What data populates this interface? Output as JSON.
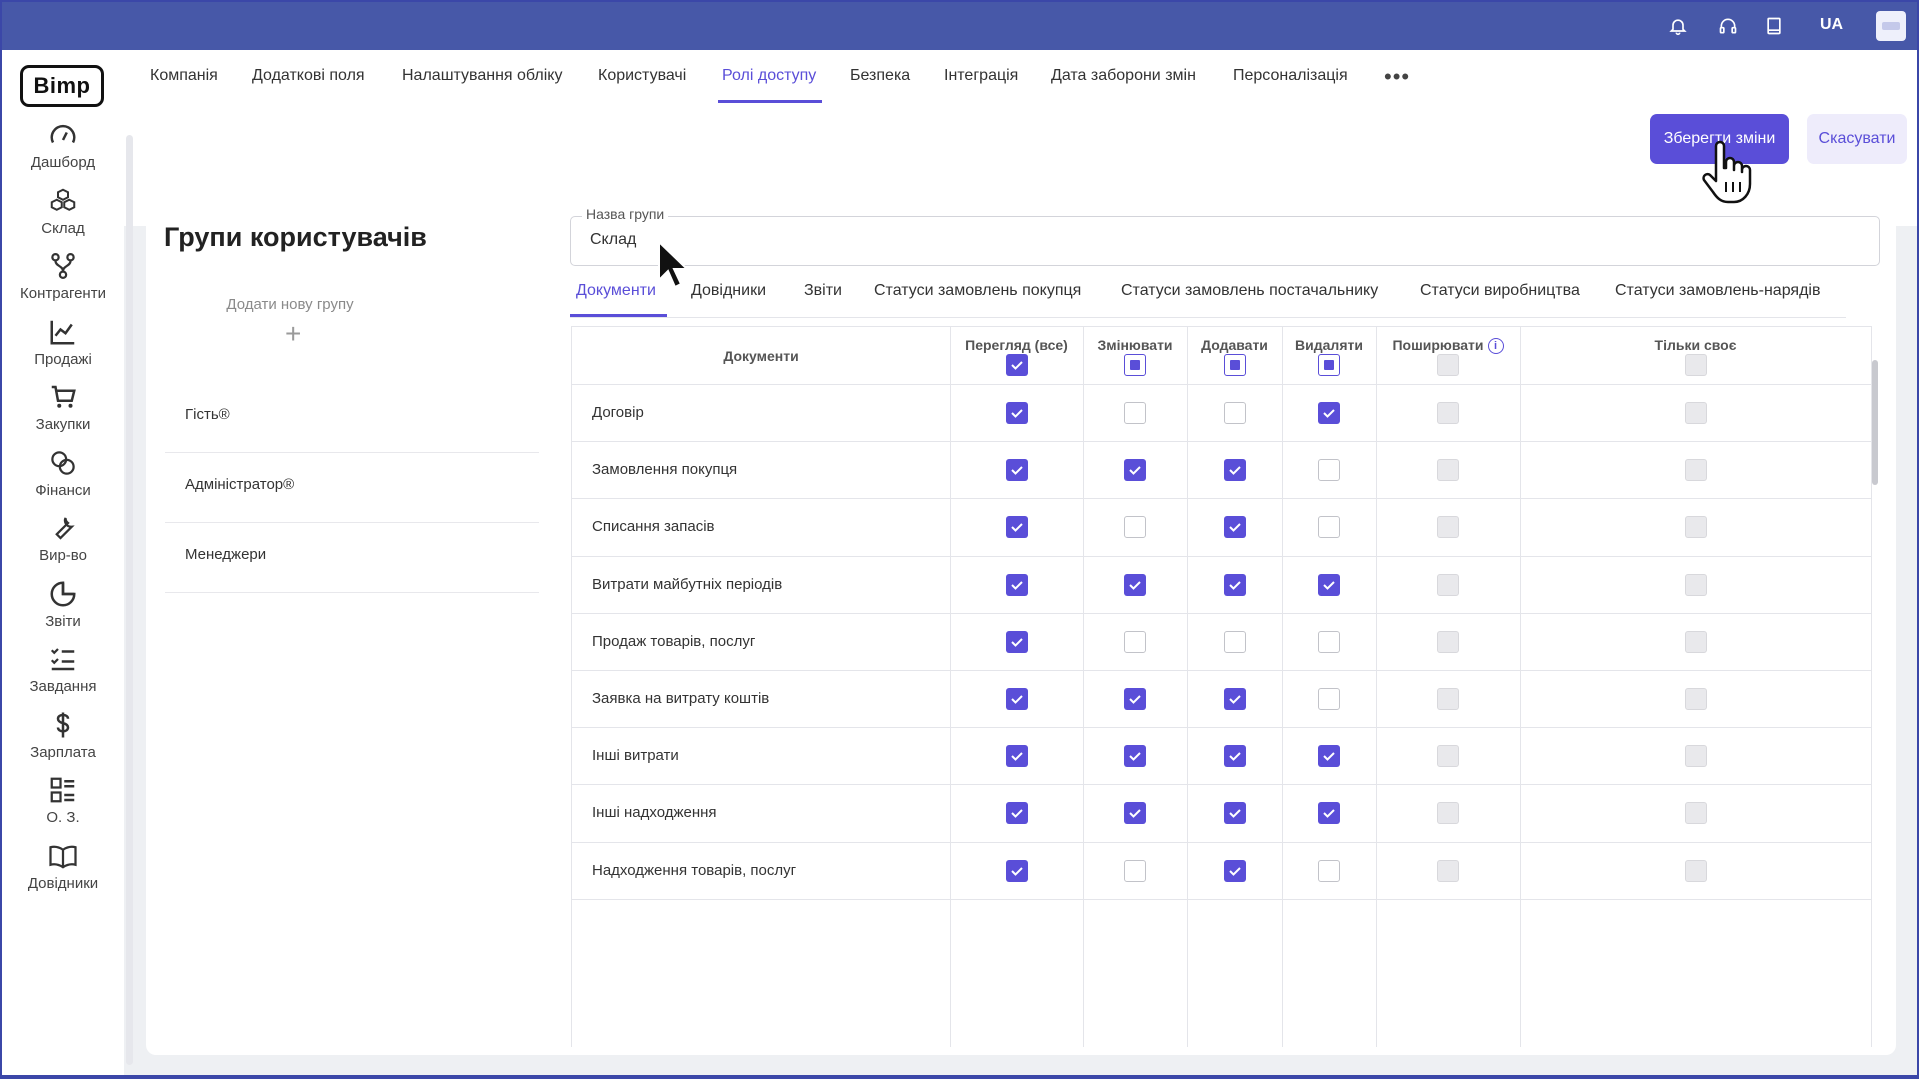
{
  "topbar": {
    "lang": "UA",
    "icons": [
      "bell-icon",
      "headset-icon",
      "book-icon"
    ]
  },
  "sidebar": {
    "logo": "Bimp",
    "items": [
      {
        "label": "Дашборд",
        "icon": "gauge-icon"
      },
      {
        "label": "Склад",
        "icon": "boxes-icon"
      },
      {
        "label": "Контрагенти",
        "icon": "network-icon"
      },
      {
        "label": "Продажі",
        "icon": "chart-line-icon"
      },
      {
        "label": "Закупки",
        "icon": "cart-icon"
      },
      {
        "label": "Фінанси",
        "icon": "coins-icon"
      },
      {
        "label": "Вир-во",
        "icon": "wrench-icon"
      },
      {
        "label": "Звіти",
        "icon": "pie-chart-icon"
      },
      {
        "label": "Завдання",
        "icon": "checklist-icon"
      },
      {
        "label": "Зарплата",
        "icon": "dollar-icon"
      },
      {
        "label": "О. З.",
        "icon": "list-icon"
      },
      {
        "label": "Довідники",
        "icon": "open-book-icon"
      }
    ]
  },
  "tabs": [
    {
      "label": "Компанія"
    },
    {
      "label": "Додаткові поля"
    },
    {
      "label": "Налаштування обліку"
    },
    {
      "label": "Користувачі"
    },
    {
      "label": "Ролі доступу",
      "active": true
    },
    {
      "label": "Безпека"
    },
    {
      "label": "Інтеграція"
    },
    {
      "label": "Дата заборони змін"
    },
    {
      "label": "Персоналізація"
    }
  ],
  "actions": {
    "save": "Зберегти зміни",
    "cancel": "Скасувати"
  },
  "groups": {
    "title": "Групи користувачів",
    "add_label": "Додати нову групу",
    "add_plus": "+",
    "items": [
      "Гість®",
      "Адміністратор®",
      "Менеджери"
    ]
  },
  "group_form": {
    "name_label": "Назва групи",
    "name_value": "Склад"
  },
  "subtabs": [
    {
      "label": "Документи",
      "active": true
    },
    {
      "label": "Довідники"
    },
    {
      "label": "Звіти"
    },
    {
      "label": "Статуси замовлень покупця"
    },
    {
      "label": "Статуси замовлень постачальнику"
    },
    {
      "label": "Статуси виробництва"
    },
    {
      "label": "Статуси замовлень-нарядів"
    }
  ],
  "permissions": {
    "columns": [
      "Документи",
      "Перегляд (все)",
      "Змінювати",
      "Додавати",
      "Видаляти",
      "Поширювати",
      "Тільки своє"
    ],
    "header_states": [
      "on",
      "ind",
      "ind",
      "ind",
      "dis",
      "dis"
    ],
    "rows": [
      {
        "name": "Договір",
        "values": [
          true,
          false,
          false,
          true
        ]
      },
      {
        "name": "Замовлення покупця",
        "values": [
          true,
          true,
          true,
          false
        ]
      },
      {
        "name": "Списання запасів",
        "values": [
          true,
          false,
          true,
          false
        ]
      },
      {
        "name": "Витрати майбутніх періодів",
        "values": [
          true,
          true,
          true,
          true
        ]
      },
      {
        "name": "Продаж товарів, послуг",
        "values": [
          true,
          false,
          false,
          false
        ]
      },
      {
        "name": "Заявка на витрату коштів",
        "values": [
          true,
          true,
          true,
          false
        ]
      },
      {
        "name": "Інші витрати",
        "values": [
          true,
          true,
          true,
          true
        ]
      },
      {
        "name": "Інші надходження",
        "values": [
          true,
          true,
          true,
          true
        ]
      },
      {
        "name": "Надходження товарів, послуг",
        "values": [
          true,
          false,
          true,
          false
        ]
      }
    ]
  },
  "colors": {
    "accent": "#5a4ed8",
    "topbar": "#4758a8"
  }
}
